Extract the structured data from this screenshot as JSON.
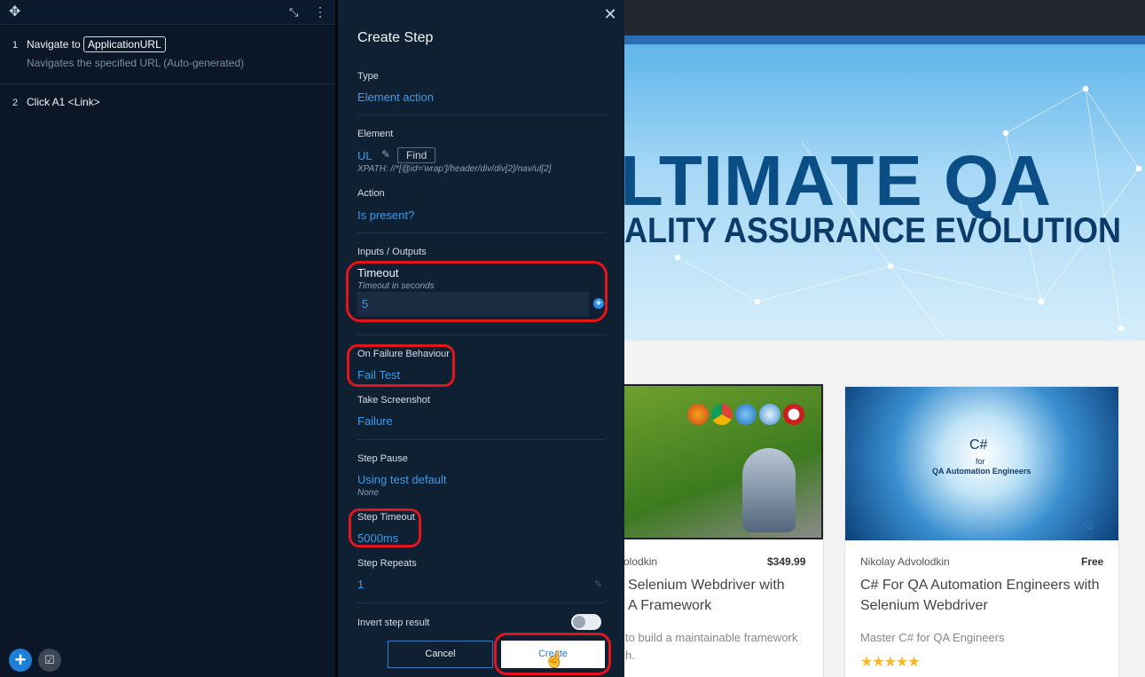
{
  "steps_panel": {
    "steps": [
      {
        "number": "1",
        "title_prefix": "Navigate to",
        "parameter": "ApplicationURL",
        "subtitle": "Navigates the specified URL (Auto-generated)"
      },
      {
        "number": "2",
        "title": "Click A1 <Link>"
      }
    ]
  },
  "dialog": {
    "title": "Create Step",
    "type_label": "Type",
    "type_value": "Element action",
    "element_label": "Element",
    "element_value": "UL",
    "find_label": "Find",
    "xpath": "XPATH: //*[@id='wrap']/header/div/div[2]/nav/ul[2]",
    "action_label": "Action",
    "action_value": "Is present?",
    "io_label": "Inputs / Outputs",
    "timeout_label": "Timeout",
    "timeout_hint": "Timeout in seconds",
    "timeout_value": "5",
    "on_failure_label": "On Failure Behaviour",
    "on_failure_value": "Fail Test",
    "screenshot_label": "Take Screenshot",
    "screenshot_value": "Failure",
    "step_pause_label": "Step Pause",
    "step_pause_value": "Using test default",
    "step_pause_sub": "None",
    "step_timeout_label": "Step Timeout",
    "step_timeout_value": "5000ms",
    "step_repeats_label": "Step Repeats",
    "step_repeats_value": "1",
    "invert_label": "Invert step result",
    "invert_on": false,
    "cancel_label": "Cancel",
    "create_label": "Create"
  },
  "site": {
    "hero_title": "LTIMATE QA",
    "hero_subtitle": "ALITY ASSURANCE EVOLUTION",
    "cards": [
      {
        "author": "olodkin",
        "price": "$349.99",
        "title_line1": "Selenium Webdriver with",
        "title_line2": "A Framework",
        "desc_line1": "to build a maintainable framework",
        "desc_line2": "h."
      },
      {
        "author": "Nikolay Advolodkin",
        "price": "Free",
        "title_line1": "C# For QA Automation Engineers with",
        "title_line2": "Selenium Webdriver",
        "desc_line1": "Master C# for QA Engineers",
        "image_title": "C#",
        "image_for": "for",
        "image_sub": "QA Automation Engineers",
        "rating": 5
      }
    ]
  },
  "colors": {
    "accent": "#3d9be9",
    "highlight": "#e3151c",
    "panel_bg": "#102033"
  }
}
